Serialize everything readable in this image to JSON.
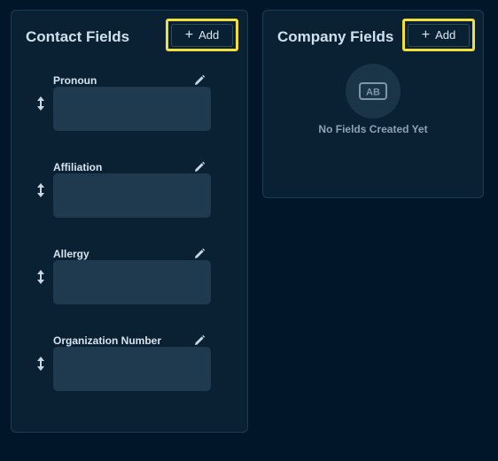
{
  "contact": {
    "title": "Contact Fields",
    "add_label": "Add",
    "fields": [
      {
        "label": "Pronoun"
      },
      {
        "label": "Affiliation"
      },
      {
        "label": "Allergy"
      },
      {
        "label": "Organization Number"
      }
    ]
  },
  "company": {
    "title": "Company Fields",
    "add_label": "Add",
    "empty_state": "No Fields Created Yet",
    "empty_icon_text": "AB"
  },
  "colors": {
    "background": "#021629",
    "panel": "#0a2133",
    "highlight": "#f1df3c",
    "input": "#1f3a4e"
  },
  "icons": {
    "add": "plus-icon",
    "edit": "pencil-icon",
    "drag": "drag-vertical-icon",
    "empty": "text-field-icon"
  }
}
